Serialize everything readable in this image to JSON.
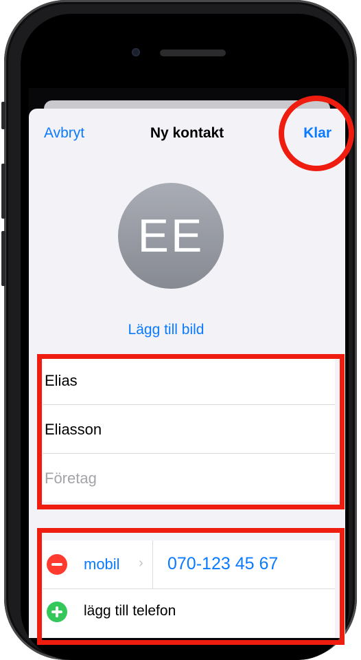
{
  "nav": {
    "cancel_label": "Avbryt",
    "title": "Ny kontakt",
    "done_label": "Klar"
  },
  "avatar": {
    "initials": "EE"
  },
  "add_photo_label": "Lägg till bild",
  "name_fields": {
    "first_name": "Elias",
    "last_name": "Eliasson",
    "company_placeholder": "Företag"
  },
  "phone": {
    "label_type": "mobil",
    "number": "070-123 45 67",
    "add_phone_label": "lägg till telefon"
  },
  "icons": {
    "remove": "minus-circle-icon",
    "add": "plus-circle-icon",
    "chevron": "chevron-right-icon"
  },
  "colors": {
    "accent": "#0a7aff",
    "remove": "#ff3b30",
    "add": "#34c759",
    "highlight": "#ee1d0f"
  }
}
